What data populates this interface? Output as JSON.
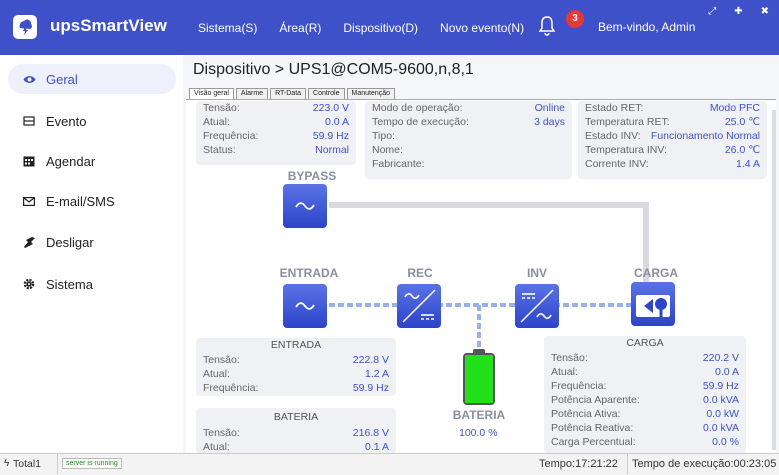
{
  "app": {
    "title": "upsSmartView"
  },
  "menu": [
    "Sistema(S)",
    "Área(R)",
    "Dispositivo(D)",
    "Novo evento(N)"
  ],
  "header": {
    "notification_count": "3",
    "welcome": "Bem-vindo, Admin"
  },
  "sidebar": {
    "items": [
      {
        "label": "Geral",
        "icon": "eye-icon"
      },
      {
        "label": "Evento",
        "icon": "event-icon"
      },
      {
        "label": "Agendar",
        "icon": "calendar-icon"
      },
      {
        "label": "E-mail/SMS",
        "icon": "mail-icon"
      },
      {
        "label": "Desligar",
        "icon": "power-icon"
      },
      {
        "label": "Sistema",
        "icon": "gear-icon"
      }
    ]
  },
  "breadcrumb": "Dispositivo > UPS1@COM5-9600,n,8,1",
  "tabs": [
    "Visão geral",
    "Alarme",
    "RT-Data",
    "Controle",
    "Manutenção"
  ],
  "summary": {
    "col1": [
      {
        "k": "Tensão:",
        "v": "223.0 V"
      },
      {
        "k": "Atual:",
        "v": "0.0 A"
      },
      {
        "k": "Frequência:",
        "v": "59.9 Hz"
      },
      {
        "k": "Status:",
        "v": "Normal"
      }
    ],
    "col2": [
      {
        "k": "Modo de operação:",
        "v": "Online"
      },
      {
        "k": "Tempo de execução:",
        "v": "3 days"
      },
      {
        "k": "Tipo:",
        "v": ""
      },
      {
        "k": "Nome:",
        "v": ""
      },
      {
        "k": "Fabricante:",
        "v": ""
      }
    ],
    "col3": [
      {
        "k": "Estado RET:",
        "v": "Modo PFC"
      },
      {
        "k": "Temperatura RET:",
        "v": "25.0 ℃"
      },
      {
        "k": "Estado INV:",
        "v": "Funcionamento Normal"
      },
      {
        "k": "Temperatura INV:",
        "v": "26.0 ℃"
      },
      {
        "k": "Corrente INV:",
        "v": "1.4 A"
      }
    ]
  },
  "diagram": {
    "bypass": "BYPASS",
    "entrada": "ENTRADA",
    "rec": "REC",
    "inv": "INV",
    "carga": "CARGA",
    "bateria": "BATERIA",
    "battery_percent": "100.0 %",
    "battery_level": 1.0
  },
  "entrada_card": {
    "title": "ENTRADA",
    "rows": [
      {
        "k": "Tensão:",
        "v": "222.8 V"
      },
      {
        "k": "Atual:",
        "v": "1.2 A"
      },
      {
        "k": "Frequência:",
        "v": "59.9 Hz"
      }
    ]
  },
  "bateria_card": {
    "title": "BATERIA",
    "rows": [
      {
        "k": "Tensão:",
        "v": "216.8 V"
      },
      {
        "k": "Atual:",
        "v": "0.1 A"
      }
    ]
  },
  "carga_card": {
    "title": "CARGA",
    "rows": [
      {
        "k": "Tensão:",
        "v": "220.2 V"
      },
      {
        "k": "Atual:",
        "v": "0.0 A"
      },
      {
        "k": "Frequência:",
        "v": "59.9 Hz"
      },
      {
        "k": "Potência Aparente:",
        "v": "0.0 kVA"
      },
      {
        "k": "Potência Ativa:",
        "v": "0.0 kW"
      },
      {
        "k": "Potência Reativa:",
        "v": "0.0 kVA"
      },
      {
        "k": "Carga Percentual:",
        "v": "0.0 %"
      }
    ]
  },
  "status_bar": {
    "total": "Total1",
    "server": "server is running",
    "time": "Tempo:17:21:22",
    "runtime": "Tempo de execução:00:23:05"
  },
  "colors": {
    "brand": "#3f51c8",
    "battery": "#22e01a",
    "value": "#3f51c8"
  }
}
